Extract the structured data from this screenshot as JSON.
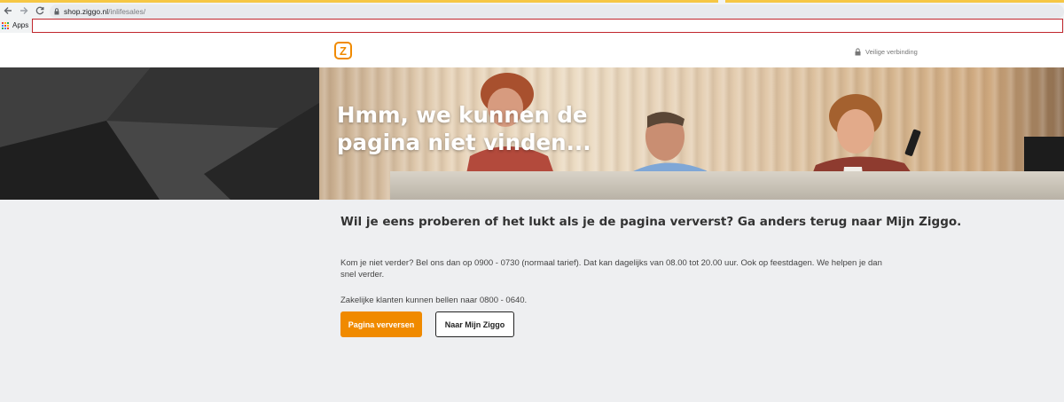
{
  "browser": {
    "url_host": "shop.ziggo.nl",
    "url_path": "/inlifesales/",
    "bookmarks_apps_label": "Apps"
  },
  "header": {
    "logo_letter": "Z",
    "secure_label": "Veilige verbinding"
  },
  "hero": {
    "title_line1": "Hmm, we kunnen de",
    "title_line2": "pagina niet vinden..."
  },
  "main": {
    "headline": "Wil je eens proberen of het lukt als je de pagina ververst? Ga anders terug naar Mijn Ziggo.",
    "paragraph1": "Kom je niet verder? Bel ons dan op 0900 - 0730 (normaal tarief). Dat kan dagelijks van 08.00 tot 20.00 uur. Ook op feestdagen. We helpen je dan snel verder.",
    "paragraph2": "Zakelijke klanten kunnen bellen naar 0800 - 0640.",
    "refresh_button": "Pagina verversen",
    "myziggo_button": "Naar Mijn Ziggo"
  },
  "colors": {
    "brand_orange": "#f08a00",
    "alert_red": "#c1272d"
  }
}
